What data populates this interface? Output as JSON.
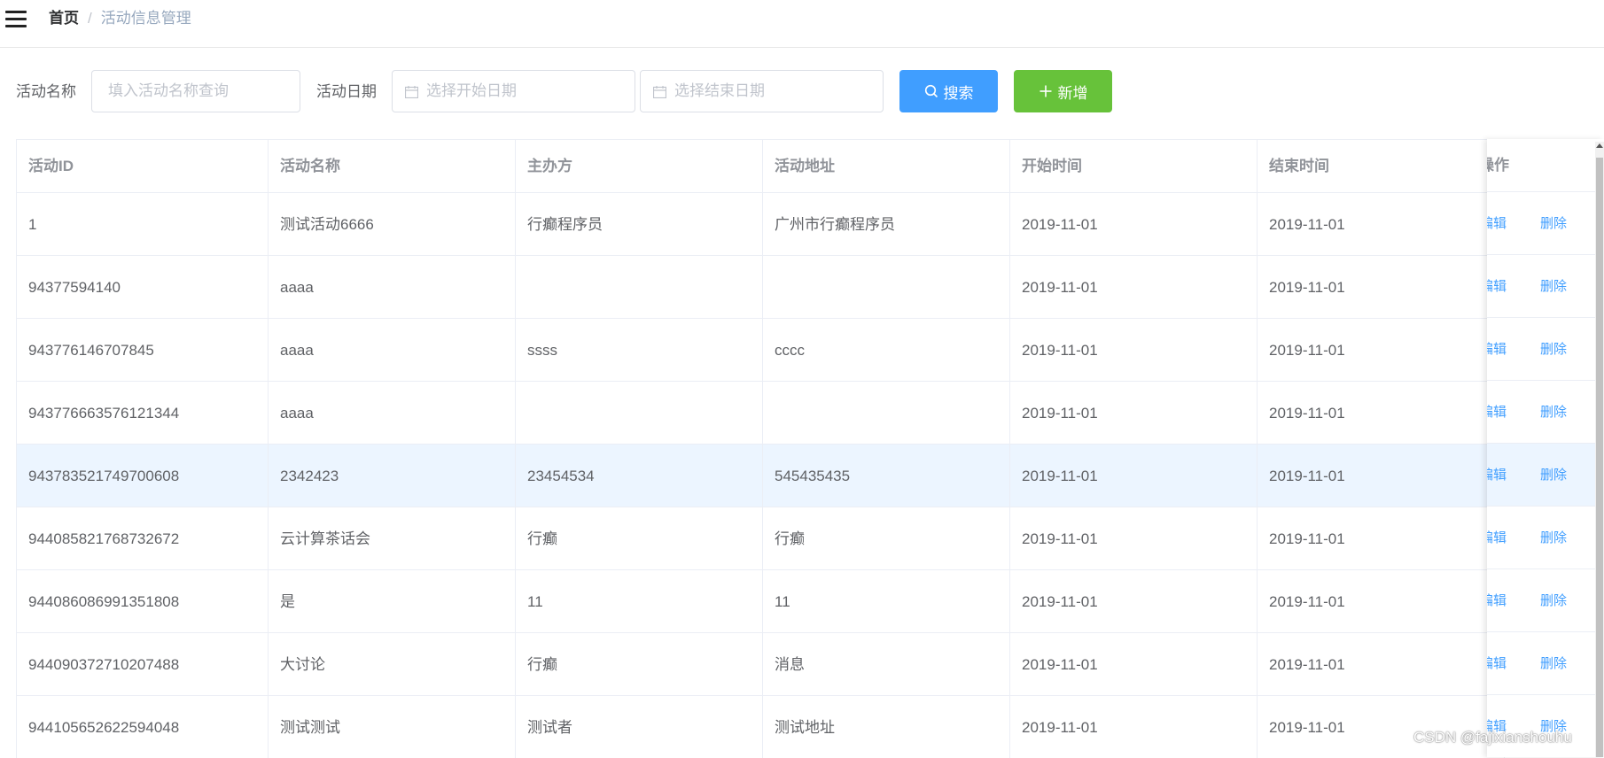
{
  "breadcrumb": {
    "home": "首页",
    "separator": "/",
    "current": "活动信息管理"
  },
  "filters": {
    "name_label": "活动名称",
    "name_placeholder": "填入活动名称查询",
    "date_label": "活动日期",
    "start_placeholder": "选择开始日期",
    "end_placeholder": "选择结束日期",
    "search_label": "搜索",
    "add_label": "新增"
  },
  "table": {
    "headers": [
      "活动ID",
      "活动名称",
      "主办方",
      "活动地址",
      "开始时间",
      "结束时间",
      "操作"
    ],
    "rows": [
      [
        "1",
        "测试活动6666",
        "行癫程序员",
        "广州市行癫程序员",
        "2019-11-01",
        "2019-11-01"
      ],
      [
        "94377594140",
        "aaaa",
        "",
        "",
        "2019-11-01",
        "2019-11-01"
      ],
      [
        "943776146707845",
        "aaaa",
        "ssss",
        "cccc",
        "2019-11-01",
        "2019-11-01"
      ],
      [
        "943776663576121344",
        "aaaa",
        "",
        "",
        "2019-11-01",
        "2019-11-01"
      ],
      [
        "943783521749700608",
        "2342423",
        "23454534",
        "545435435",
        "2019-11-01",
        "2019-11-01"
      ],
      [
        "944085821768732672",
        "云计算茶话会",
        "行癫",
        "行癫",
        "2019-11-01",
        "2019-11-01"
      ],
      [
        "944086086991351808",
        "是",
        "11",
        "11",
        "2019-11-01",
        "2019-11-01"
      ],
      [
        "944090372710207488",
        "大讨论",
        "行癫",
        "消息",
        "2019-11-01",
        "2019-11-01"
      ],
      [
        "944105652622594048",
        "测试测试",
        "测试者",
        "测试地址",
        "2019-11-01",
        "2019-11-01"
      ]
    ],
    "highlighted_row": 4,
    "edit_label": "编辑",
    "delete_label": "删除"
  },
  "watermark": "CSDN @fajixianshouhu",
  "colors": {
    "primary": "#409eff",
    "success": "#67c23a",
    "highlight_row": "#ecf5ff"
  },
  "icons": {
    "menu": "hamburger-icon",
    "calendar": "calendar-icon",
    "search": "search-icon",
    "add": "plus-icon"
  }
}
